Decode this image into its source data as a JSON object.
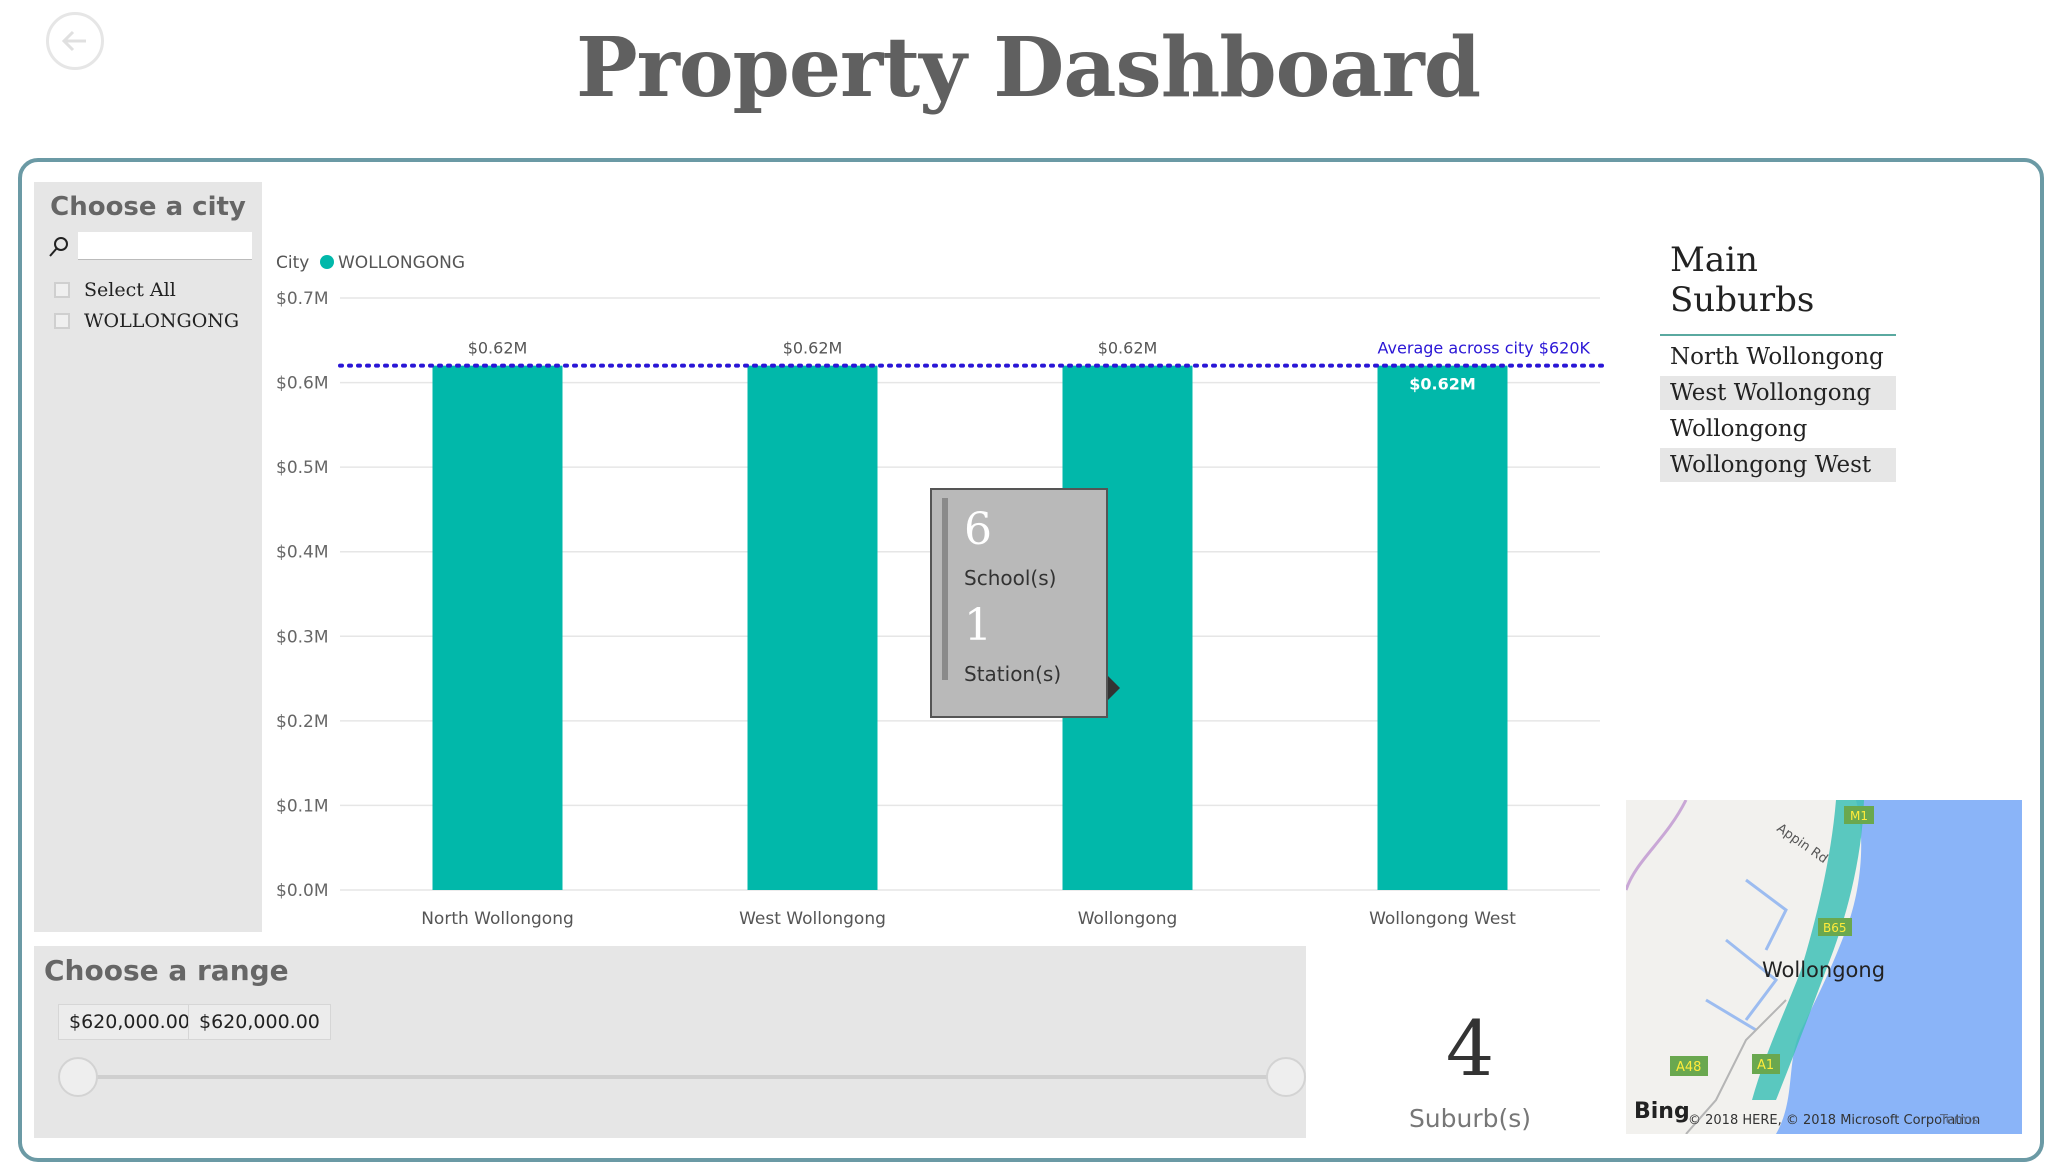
{
  "page": {
    "title": "Property Dashboard"
  },
  "back_button": {
    "icon": "back-arrow-icon"
  },
  "city_slicer": {
    "title": "Choose a city",
    "search_placeholder": "",
    "search_icon": "search-icon",
    "items": [
      {
        "label": "Select All",
        "checked": false
      },
      {
        "label": "WOLLONGONG",
        "checked": false
      }
    ]
  },
  "chart_data": {
    "type": "bar",
    "legend_title": "City",
    "legend_entries": [
      "WOLLONGONG"
    ],
    "legend_placement": "top-left",
    "series": [
      {
        "name": "WOLLONGONG",
        "color": "#01b8aa",
        "values": [
          0.62,
          0.62,
          0.62,
          0.62
        ]
      }
    ],
    "categories": [
      "North Wollongong",
      "West Wollongong",
      "Wollongong",
      "Wollongong West"
    ],
    "data_labels": [
      "$0.62M",
      "$0.62M",
      "$0.62M",
      "$0.62M"
    ],
    "y_ticks": [
      "$0.0M",
      "$0.1M",
      "$0.2M",
      "$0.3M",
      "$0.4M",
      "$0.5M",
      "$0.6M",
      "$0.7M"
    ],
    "ylim": [
      0,
      0.7
    ],
    "grid": true,
    "reference_line": {
      "label": "Average across city $620K",
      "value": 0.62,
      "color": "#2a16d6"
    }
  },
  "tooltip": {
    "schools_value": "6",
    "schools_label": "School(s)",
    "stations_value": "1",
    "stations_label": "Station(s)"
  },
  "main_suburbs": {
    "title": "Main Suburbs",
    "items": [
      "North Wollongong",
      "West Wollongong",
      "Wollongong",
      "Wollongong West"
    ]
  },
  "range_slicer": {
    "title": "Choose a range",
    "min_value": "$620,000.00",
    "max_value": "$620,000.00",
    "start": 0,
    "end": 1
  },
  "card": {
    "value": "4",
    "label": "Suburb(s)"
  },
  "map": {
    "city_label": "Wollongong",
    "road_labels": [
      "M1",
      "Appin Rd",
      "B65",
      "A48",
      "A1"
    ],
    "bing_label": "Bing",
    "copyright": "© 2018 HERE, © 2018 Microsoft Corporation",
    "terms": "Terms",
    "colors": {
      "sea": "#8ab4f8",
      "land": "#f2f1ee",
      "region": "#3fc1b6"
    }
  }
}
